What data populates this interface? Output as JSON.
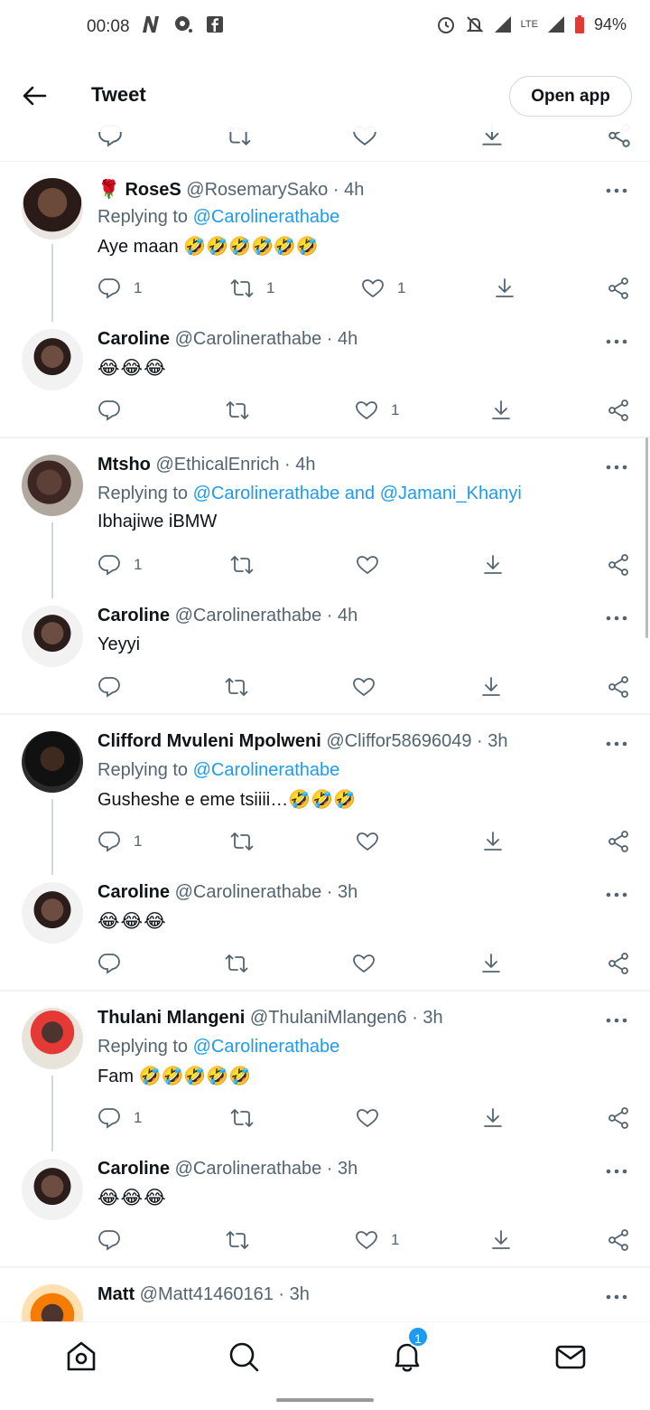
{
  "status_bar": {
    "time": "00:08",
    "network": "LTE",
    "battery": "94%"
  },
  "header": {
    "title": "Tweet",
    "open_app": "Open app"
  },
  "colors": {
    "link": "#1d9bf0",
    "text": "#0f1419",
    "muted": "#536471"
  },
  "tweets": [
    {
      "name": "RoseS",
      "handle": "@RosemarySako · 4h",
      "replying_label": "Replying to",
      "replying_to": "@Carolinerathabe",
      "text": "Aye maan 🤣🤣🤣🤣🤣🤣",
      "replies": "1",
      "retweets": "1",
      "likes": "1"
    },
    {
      "name": "Caroline",
      "handle": "@Carolinerathabe · 4h",
      "text": "😂😂😂",
      "likes": "1"
    },
    {
      "name": "Mtsho",
      "handle": "@EthicalEnrich · 4h",
      "replying_label": "Replying to",
      "replying_to": "@Carolinerathabe and @Jamani_Khanyi",
      "text": "Ibhajiwe iBMW",
      "replies": "1"
    },
    {
      "name": "Caroline",
      "handle": "@Carolinerathabe · 4h",
      "text": "Yeyyi"
    },
    {
      "name": "Clifford Mvuleni Mpolweni",
      "handle": "@Cliffor58696049 · 3h",
      "replying_label": "Replying to",
      "replying_to": "@Carolinerathabe",
      "text": "Gusheshe e eme tsiiii…🤣🤣🤣",
      "replies": "1"
    },
    {
      "name": "Caroline",
      "handle": "@Carolinerathabe · 3h",
      "text": "😂😂😂"
    },
    {
      "name": "Thulani Mlangeni",
      "handle": "@ThulaniMlangen6 · 3h",
      "replying_label": "Replying to",
      "replying_to": "@Carolinerathabe",
      "text": "Fam 🤣🤣🤣🤣🤣",
      "replies": "1"
    },
    {
      "name": "Caroline",
      "handle": "@Carolinerathabe · 3h",
      "text": "😂😂😂",
      "likes": "1"
    },
    {
      "name": "Matt",
      "handle": "@Matt41460161 · 3h"
    }
  ],
  "bottom_nav": {
    "notifications_badge": "1"
  }
}
